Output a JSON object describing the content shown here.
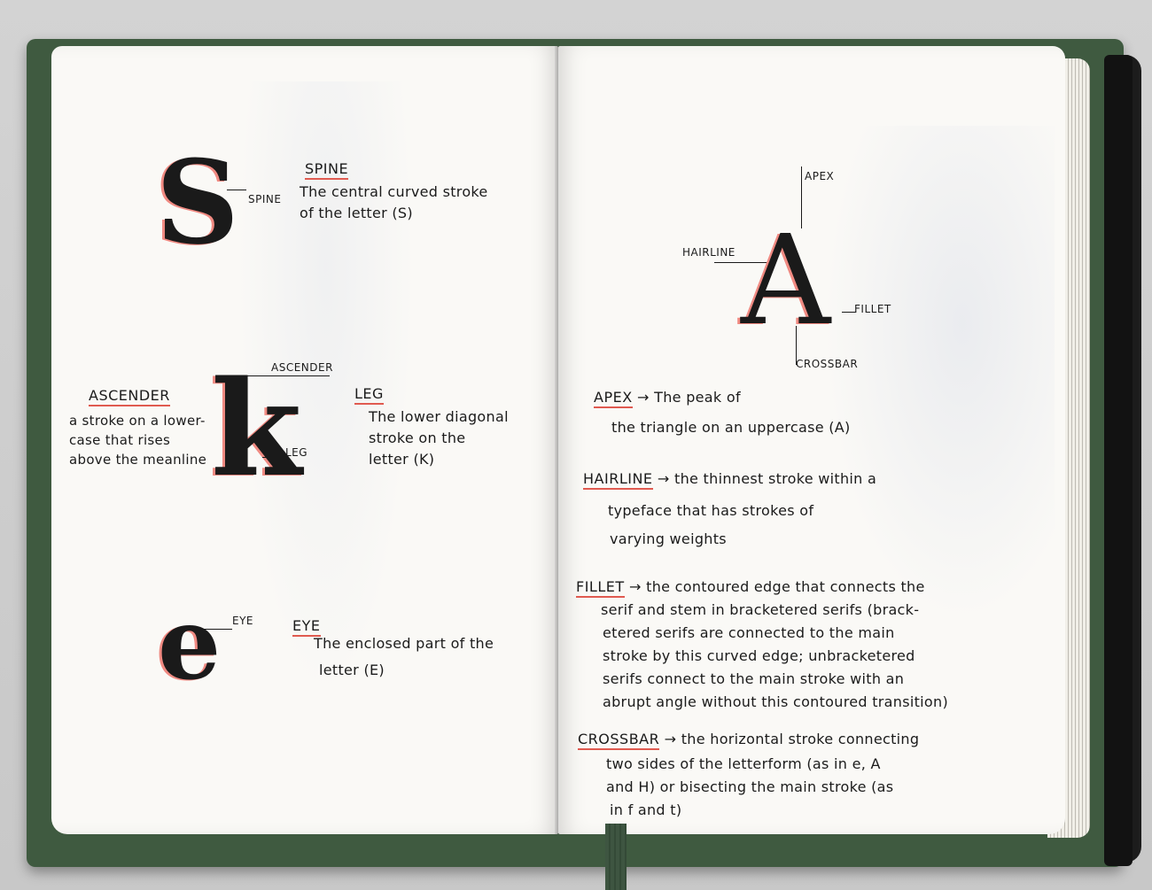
{
  "left_page": {
    "s_glyph": "S",
    "s_label": "SPINE",
    "spine_term": "SPINE",
    "spine_def": [
      "The central curved stroke",
      "of the letter (S)"
    ],
    "k_glyph": "k",
    "k_ascender_label": "ASCENDER",
    "k_leg_label": "LEG",
    "ascender_term": "ASCENDER",
    "ascender_def": [
      "a stroke on a lower-",
      "case that rises",
      "above the meanline"
    ],
    "leg_term": "LEG",
    "leg_def": [
      "The lower diagonal",
      "stroke on the",
      "letter (K)"
    ],
    "e_glyph": "e",
    "e_label": "EYE",
    "eye_term": "EYE",
    "eye_def": [
      "The enclosed part of the",
      "letter (E)"
    ]
  },
  "right_page": {
    "a_glyph": "A",
    "label_apex": "APEX",
    "label_hairline": "HAIRLINE",
    "label_fillet": "FILLET",
    "label_crossbar": "CROSSBAR",
    "apex_term": "APEX",
    "apex_def": [
      "The peak of",
      "the triangle on an uppercase (A)"
    ],
    "hairline_term": "HAIRLINE",
    "hairline_def": [
      "the thinnest stroke within a",
      "typeface that has strokes of",
      "varying weights"
    ],
    "fillet_term": "FILLET",
    "fillet_def": [
      "the contoured edge that connects the",
      "serif and stem in bracketered serifs (brack-",
      "etered serifs are connected to the main",
      "stroke by this curved edge; unbracketered",
      "serifs connect to the main stroke with an",
      "abrupt angle without this contoured transition)"
    ],
    "crossbar_term": "CROSSBAR",
    "crossbar_def": [
      "the horizontal stroke connecting",
      "two sides of the letterform (as in e, A",
      "and H) or bisecting the main stroke (as",
      "in f and t)"
    ]
  },
  "colors": {
    "cover_green": "#3f5a40",
    "paper": "#faf9f6",
    "ink": "#1b1b1b",
    "underline_red": "#e05a50",
    "bleed_blue": "#6e82b4"
  }
}
